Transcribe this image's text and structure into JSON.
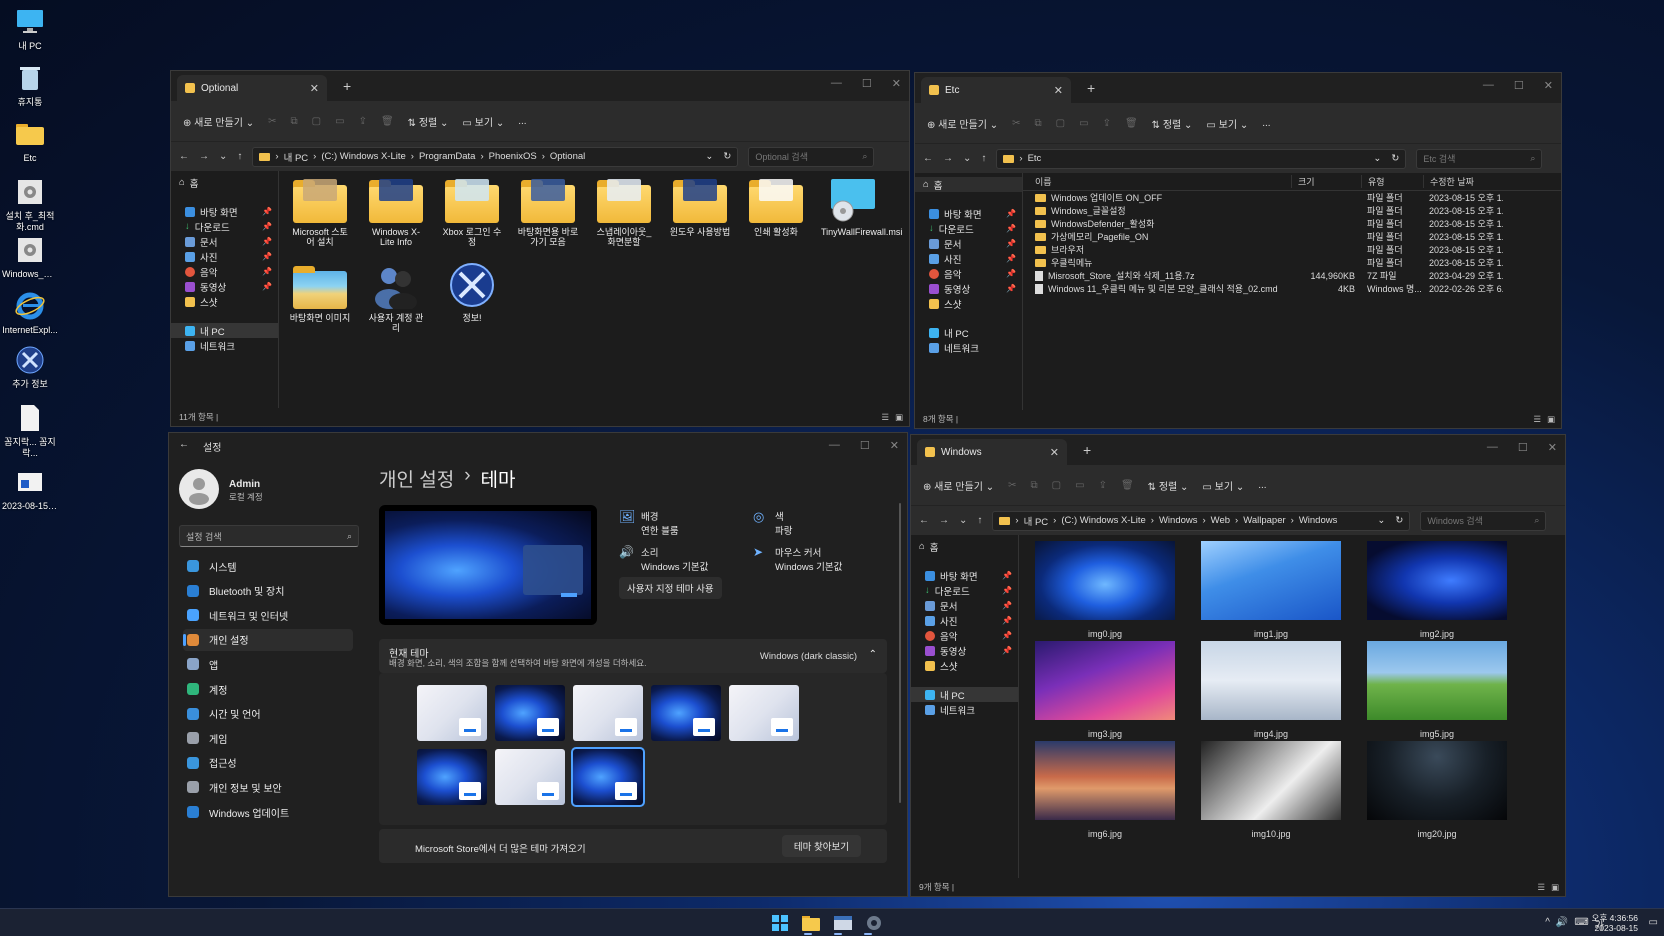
{
  "desktop": {
    "icons": [
      {
        "label": "내 PC",
        "icon": "monitor-icon"
      },
      {
        "label": "휴지통",
        "icon": "recycle-bin-icon"
      },
      {
        "label": "Etc",
        "icon": "folder-icon"
      },
      {
        "label": "설치 후_최적화.cmd",
        "icon": "gear-file-icon"
      },
      {
        "label": "Windows_정...",
        "icon": "gear-file-icon"
      },
      {
        "label": "InternetExpl...",
        "icon": "internet-explorer-icon"
      },
      {
        "label": "추가 정보",
        "icon": "xlite-icon"
      },
      {
        "label": "꼼지락... 꼼지락...",
        "icon": "text-file-icon"
      },
      {
        "label": "2023-08-15_...",
        "icon": "screenshot-file-icon"
      }
    ]
  },
  "explorer_optional": {
    "tab_title": "Optional",
    "toolbar": {
      "new_label": "새로 만들기",
      "sort_label": "정렬",
      "view_label": "보기",
      "more": "..."
    },
    "path": [
      "내 PC",
      "(C:) Windows X-Lite",
      "ProgramData",
      "PhoenixOS",
      "Optional"
    ],
    "search_placeholder": "Optional 검색",
    "nav": {
      "home": "홈",
      "quick": [
        "바탕 화면",
        "다운로드",
        "문서",
        "사진",
        "음악",
        "동영상",
        "스샷"
      ],
      "this_pc": "내 PC",
      "network": "네트워크"
    },
    "items": [
      "Microsoft 스토어 설치",
      "Windows X-Lite Info",
      "Xbox 로그인 수정",
      "바탕화면용 바로가기 모음",
      "스냅레이아웃_화면분할",
      "윈도우 사용방법",
      "인쇄 활성화",
      "TinyWallFirewall.msi",
      "바탕화면 이미지",
      "사용자 계정 관리",
      "정보!"
    ],
    "status": "11개 항목 |"
  },
  "explorer_etc": {
    "tab_title": "Etc",
    "toolbar": {
      "new_label": "새로 만들기",
      "sort_label": "정렬",
      "view_label": "보기",
      "more": "..."
    },
    "path": [
      "Etc"
    ],
    "search_placeholder": "Etc 검색",
    "nav": {
      "home": "홈",
      "quick": [
        "바탕 화면",
        "다운로드",
        "문서",
        "사진",
        "음악",
        "동영상",
        "스샷"
      ],
      "this_pc": "내 PC",
      "network": "네트워크"
    },
    "columns": [
      "이름",
      "크기",
      "유형",
      "수정한 날짜"
    ],
    "rows": [
      {
        "name": "Windows 업데이트 ON_OFF",
        "size": "",
        "type": "파일 폴더",
        "date": "2023-08-15 오후 1...",
        "kind": "folder"
      },
      {
        "name": "Windows_글꼴설정",
        "size": "",
        "type": "파일 폴더",
        "date": "2023-08-15 오후 1...",
        "kind": "folder"
      },
      {
        "name": "WindowsDefender_활성화",
        "size": "",
        "type": "파일 폴더",
        "date": "2023-08-15 오후 1...",
        "kind": "folder"
      },
      {
        "name": "가상메모리_Pagefile_ON",
        "size": "",
        "type": "파일 폴더",
        "date": "2023-08-15 오후 1...",
        "kind": "folder"
      },
      {
        "name": "브라우저",
        "size": "",
        "type": "파일 폴더",
        "date": "2023-08-15 오후 1...",
        "kind": "folder"
      },
      {
        "name": "우클릭메뉴",
        "size": "",
        "type": "파일 폴더",
        "date": "2023-08-15 오후 1...",
        "kind": "folder"
      },
      {
        "name": "Misrosoft_Store_설치와 삭제_11용.7z",
        "size": "144,960KB",
        "type": "7Z 파일",
        "date": "2023-04-29 오후 1...",
        "kind": "file"
      },
      {
        "name": "Windows 11_우클릭 메뉴 및 리본 모양_클래식 적용_02.cmd",
        "size": "4KB",
        "type": "Windows 명...",
        "date": "2022-02-26 오후 6...",
        "kind": "file"
      }
    ],
    "status": "8개 항목 |"
  },
  "settings": {
    "window_title": "설정",
    "user": {
      "name": "Admin",
      "sub": "로컬 계정"
    },
    "search_placeholder": "설정 검색",
    "nav": [
      {
        "label": "시스템",
        "color": "#3a96dd"
      },
      {
        "label": "Bluetooth 및 장치",
        "color": "#2a7fd4"
      },
      {
        "label": "네트워크 및 인터넷",
        "color": "#4aa3ff"
      },
      {
        "label": "개인 설정",
        "color": "#e08a3a"
      },
      {
        "label": "앱",
        "color": "#8aa4c8"
      },
      {
        "label": "계정",
        "color": "#2fb67c"
      },
      {
        "label": "시간 및 언어",
        "color": "#3a8fdc"
      },
      {
        "label": "게임",
        "color": "#9aa0aa"
      },
      {
        "label": "접근성",
        "color": "#3a96dd"
      },
      {
        "label": "개인 정보 및 보안",
        "color": "#9aa0aa"
      },
      {
        "label": "Windows 업데이트",
        "color": "#2a7fd4"
      }
    ],
    "breadcrumb_parent": "개인 설정",
    "breadcrumb_sep": "›",
    "breadcrumb_current": "테마",
    "props": {
      "background_label": "배경",
      "background_value": "연한 블룸",
      "color_label": "색",
      "color_value": "파랑",
      "sound_label": "소리",
      "sound_value": "Windows 기본값",
      "cursor_label": "마우스 커서",
      "cursor_value": "Windows 기본값"
    },
    "custom_theme_button": "사용자 지정 테마 사용",
    "current_theme_title": "현재 테마",
    "current_theme_desc": "배경 화면, 소리, 색의 조합을 함께 선택하여 바탕 화면에 개성을 더하세요.",
    "current_theme_value": "Windows (dark classic)",
    "store_text": "Microsoft Store에서 더 많은 테마 가져오기",
    "browse_button": "테마 찾아보기"
  },
  "explorer_windows": {
    "tab_title": "Windows",
    "toolbar": {
      "new_label": "새로 만들기",
      "sort_label": "정렬",
      "view_label": "보기",
      "more": "..."
    },
    "path": [
      "내 PC",
      "(C:) Windows X-Lite",
      "Windows",
      "Web",
      "Wallpaper",
      "Windows"
    ],
    "search_placeholder": "Windows 검색",
    "nav": {
      "home": "홈",
      "quick": [
        "바탕 화면",
        "다운로드",
        "문서",
        "사진",
        "음악",
        "동영상",
        "스샷"
      ],
      "this_pc": "내 PC",
      "network": "네트워크"
    },
    "images": [
      "img0.jpg",
      "img1.jpg",
      "img2.jpg",
      "img3.jpg",
      "img4.jpg",
      "img5.jpg",
      "img6.jpg",
      "img10.jpg",
      "img20.jpg"
    ],
    "status": "9개 항목 |"
  },
  "taskbar": {
    "time": "오후 4:36:56",
    "date": "2023-08-15",
    "ime": "가",
    "tray_chevron": "^"
  }
}
